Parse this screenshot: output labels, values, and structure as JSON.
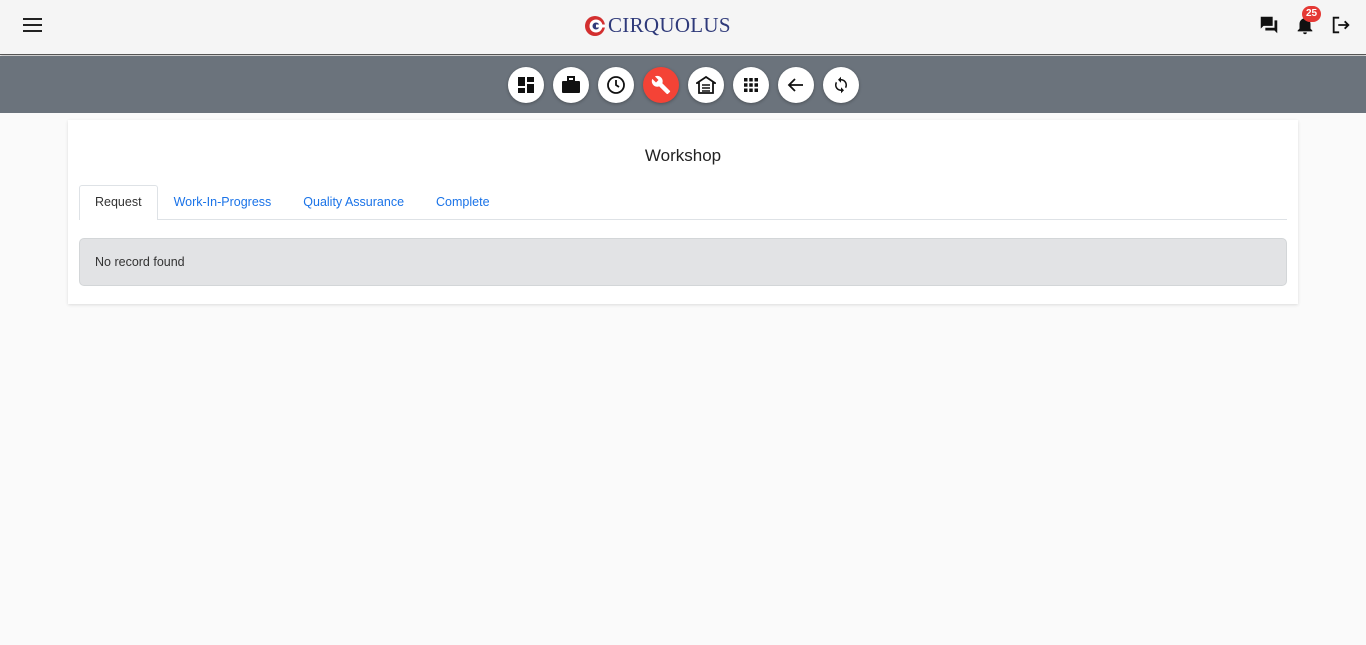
{
  "header": {
    "brand": "CIRQUOLUS",
    "notification_count": "25"
  },
  "toolbar": {
    "buttons": [
      "dashboard",
      "jobs",
      "history",
      "workshop",
      "warehouse",
      "apps",
      "back",
      "refresh"
    ],
    "active": "workshop",
    "accent": "#f44336"
  },
  "page": {
    "title": "Workshop",
    "tabs": [
      "Request",
      "Work-In-Progress",
      "Quality Assurance",
      "Complete"
    ],
    "active_tab": "Request",
    "empty_message": "No record found"
  }
}
